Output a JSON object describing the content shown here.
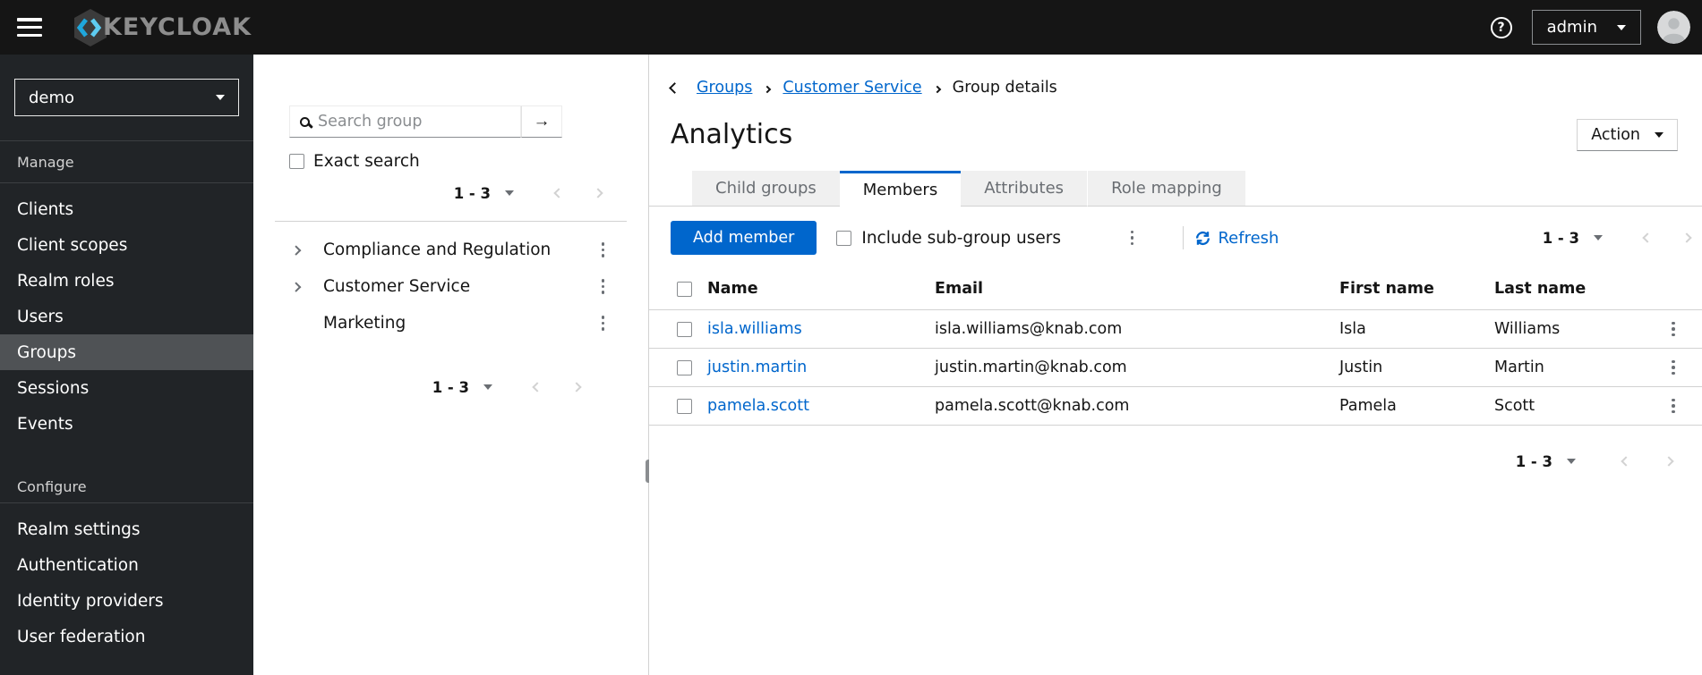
{
  "colors": {
    "accent": "#0066cc",
    "masthead_bg": "#151515",
    "sidebar_bg": "#212427",
    "sidebar_selected_bg": "#4f5255",
    "link": "#0066cc",
    "tab_inactive_bg": "#f0f0f0",
    "muted_text": "#6a6e73",
    "border": "#d2d2d2"
  },
  "masthead": {
    "brand_text": "KEYCLOAK",
    "menu_icon": "hamburger-icon",
    "help_icon": "question-circle-icon",
    "help_glyph": "?",
    "username": "admin",
    "avatar_icon": "user-avatar-icon"
  },
  "sidebar": {
    "realm_select": {
      "value": "demo"
    },
    "sections": [
      {
        "label": "Manage",
        "items": [
          {
            "label": "Clients",
            "selected": false
          },
          {
            "label": "Client scopes",
            "selected": false
          },
          {
            "label": "Realm roles",
            "selected": false
          },
          {
            "label": "Users",
            "selected": false
          },
          {
            "label": "Groups",
            "selected": true
          },
          {
            "label": "Sessions",
            "selected": false
          },
          {
            "label": "Events",
            "selected": false
          }
        ]
      },
      {
        "label": "Configure",
        "items": [
          {
            "label": "Realm settings",
            "selected": false
          },
          {
            "label": "Authentication",
            "selected": false
          },
          {
            "label": "Identity providers",
            "selected": false
          },
          {
            "label": "User federation",
            "selected": false
          }
        ]
      }
    ]
  },
  "groups_panel": {
    "search_placeholder": "Search group",
    "search_icon": "magnifier-icon",
    "submit_icon": "arrow-right-icon",
    "submit_glyph": "→",
    "exact_search_label": "Exact search",
    "pagination_top": {
      "range": "1 - 3"
    },
    "tree_items": [
      {
        "name": "Compliance and Regulation",
        "expandable": true
      },
      {
        "name": "Customer Service",
        "expandable": true
      },
      {
        "name": "Marketing",
        "expandable": false
      }
    ],
    "pagination_bottom": {
      "range": "1 - 3"
    }
  },
  "content": {
    "breadcrumb": {
      "items": [
        {
          "label": "Groups",
          "link": true
        },
        {
          "label": "Customer Service",
          "link": true
        },
        {
          "label": "Group details",
          "link": false
        }
      ]
    },
    "page_title": "Analytics",
    "action_menu_label": "Action",
    "tabs": [
      {
        "label": "Child groups",
        "active": false
      },
      {
        "label": "Members",
        "active": true
      },
      {
        "label": "Attributes",
        "active": false
      },
      {
        "label": "Role mapping",
        "active": false
      }
    ],
    "toolbar": {
      "add_member_label": "Add member",
      "include_subgroup_label": "Include sub-group users",
      "refresh_label": "Refresh",
      "pagination": {
        "range": "1 - 3"
      }
    },
    "members_table": {
      "columns": [
        "Name",
        "Email",
        "First name",
        "Last name"
      ],
      "rows": [
        {
          "name": "isla.williams",
          "email": "isla.williams@knab.com",
          "first_name": "Isla",
          "last_name": "Williams"
        },
        {
          "name": "justin.martin",
          "email": "justin.martin@knab.com",
          "first_name": "Justin",
          "last_name": "Martin"
        },
        {
          "name": "pamela.scott",
          "email": "pamela.scott@knab.com",
          "first_name": "Pamela",
          "last_name": "Scott"
        }
      ]
    },
    "pagination_bottom": {
      "range": "1 - 3"
    }
  }
}
